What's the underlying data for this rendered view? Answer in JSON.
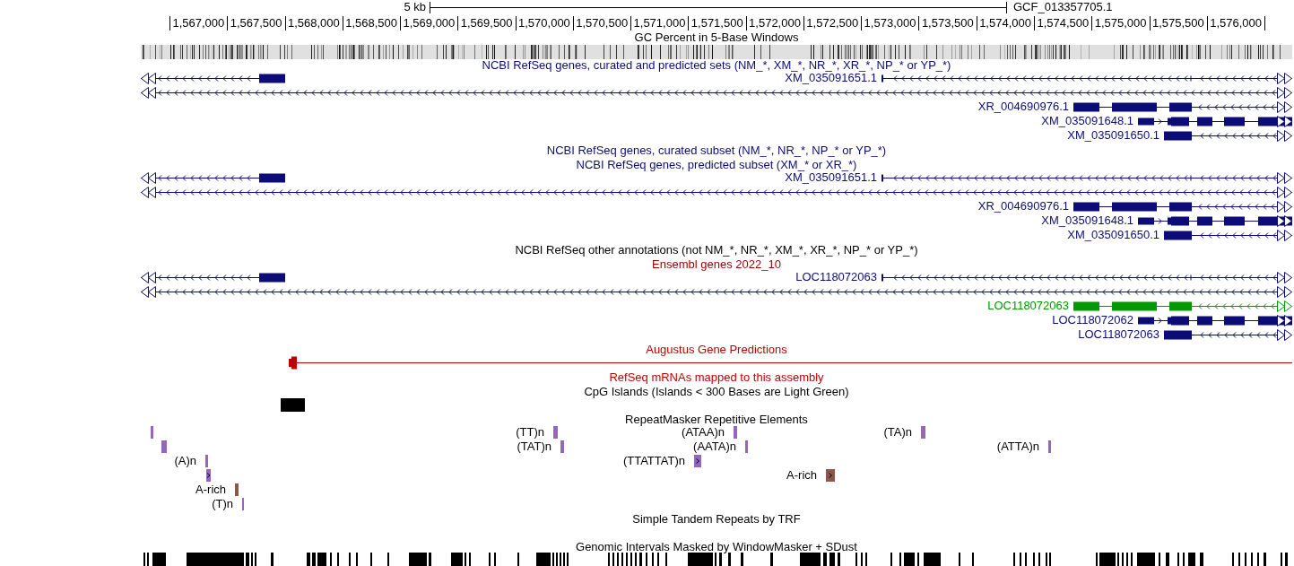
{
  "ruler": {
    "scale_label": "5 kb",
    "assembly": "GCF_013357705.1",
    "positions": [
      "1,567,000",
      "1,567,500",
      "1,568,000",
      "1,568,500",
      "1,569,000",
      "1,569,500",
      "1,570,000",
      "1,570,500",
      "1,571,000",
      "1,571,500",
      "1,572,000",
      "1,572,500",
      "1,573,000",
      "1,573,500",
      "1,574,000",
      "1,574,500",
      "1,575,000",
      "1,575,500",
      "1,576,000"
    ]
  },
  "tracks": [
    {
      "kind": "gc",
      "title": "GC Percent in 5-Base Windows",
      "color": "#000000"
    },
    {
      "kind": "genes",
      "title": "NCBI RefSeq genes, curated and predicted sets (NM_*, XM_*, NR_*, XR_*, NP_* or YP_*)",
      "color": "#0c0c78",
      "genes": [
        {
          "reverse": true
        },
        {
          "label": "XM_035091651.1",
          "reverse": true
        },
        {
          "reverse": true
        },
        {
          "label": "XR_004690976.1",
          "reverse": true
        },
        {
          "label": "XM_035091648.1",
          "reverse": false
        },
        {
          "label": "XM_035091650.1",
          "reverse": true
        }
      ]
    },
    {
      "kind": "empty",
      "title": "NCBI RefSeq genes, curated subset (NM_*, NR_*, NP_* or YP_*)",
      "color": "#0c0c78"
    },
    {
      "kind": "genes",
      "title": "NCBI RefSeq genes, predicted subset (XM_* or XR_*)",
      "color": "#0c0c78",
      "genes": [
        {
          "reverse": true
        },
        {
          "label": "XM_035091651.1",
          "reverse": true
        },
        {
          "reverse": true
        },
        {
          "label": "XR_004690976.1",
          "reverse": true
        },
        {
          "label": "XM_035091648.1",
          "reverse": false
        },
        {
          "label": "XM_035091650.1",
          "reverse": true
        }
      ]
    },
    {
      "kind": "empty",
      "title": "NCBI RefSeq other annotations (not NM_*, NR_*, XM_*, XR_*, NP_* or YP_*)",
      "color": "#000000"
    },
    {
      "kind": "genes",
      "title": "Ensembl genes 2022_10",
      "color": "#990000",
      "genes": [
        {
          "reverse": true,
          "color": "#0c0c78"
        },
        {
          "label": "LOC118072063",
          "reverse": true,
          "color": "#0c0c78"
        },
        {
          "reverse": true,
          "color": "#0c0c78"
        },
        {
          "label": "LOC118072063",
          "reverse": true,
          "color": "#009a00"
        },
        {
          "label": "LOC118072062",
          "reverse": false,
          "color": "#0c0c78"
        },
        {
          "label": "LOC118072063",
          "reverse": true,
          "color": "#0c0c78"
        }
      ]
    },
    {
      "kind": "prediction",
      "title": "Augustus Gene Predictions",
      "color": "#c00000"
    },
    {
      "kind": "empty",
      "title": "RefSeq mRNAs mapped to this assembly",
      "color": "#c00000"
    },
    {
      "kind": "cpg",
      "title": "CpG Islands (Islands < 300 Bases are Light Green)",
      "color": "#000000"
    },
    {
      "kind": "repeats",
      "title": "RepeatMasker Repetitive Elements",
      "color": "#000000",
      "items": [
        {
          "color": "#9467bd"
        },
        {
          "label": "(TT)n",
          "color": "#9467bd"
        },
        {
          "label": "(ATAA)n",
          "color": "#9467bd"
        },
        {
          "label": "(TA)n",
          "color": "#9467bd"
        },
        {
          "color": "#9467bd"
        },
        {
          "label": "(TAT)n",
          "color": "#9467bd"
        },
        {
          "label": "(AATA)n",
          "color": "#9467bd"
        },
        {
          "label": "(ATTA)n",
          "color": "#9467bd"
        },
        {
          "label": "(A)n",
          "color": "#9467bd"
        },
        {
          "label": "(TTATTAT)n",
          "color": "#9467bd"
        },
        {
          "color": "#9467bd"
        },
        {
          "label": "A-rich",
          "color": "#8c564b"
        },
        {
          "label": "A-rich",
          "color": "#8c564b"
        },
        {
          "label": "(T)n",
          "color": "#9467bd"
        }
      ]
    },
    {
      "kind": "empty_row",
      "title": "Simple Tandem Repeats by TRF",
      "color": "#000000"
    },
    {
      "kind": "mask",
      "title": "Genomic Intervals Masked by WindowMasker + SDust",
      "color": "#000000"
    }
  ]
}
